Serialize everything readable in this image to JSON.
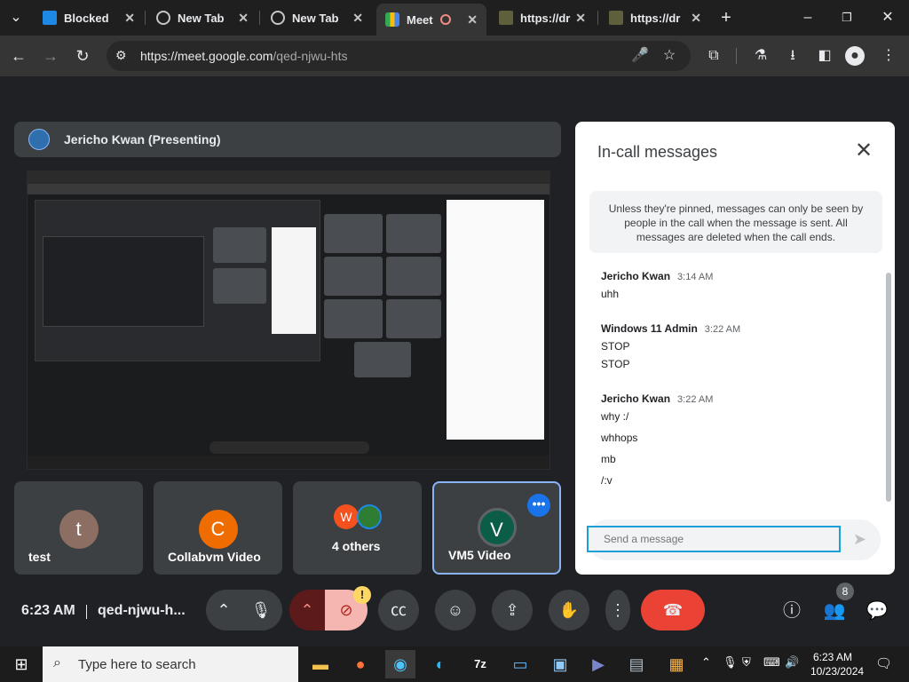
{
  "browser": {
    "tabs": [
      {
        "label": "Blocked",
        "active": false
      },
      {
        "label": "New Tab",
        "active": false
      },
      {
        "label": "New Tab",
        "active": false
      },
      {
        "label": "Meet",
        "active": true
      },
      {
        "label": "https://dr",
        "active": false
      },
      {
        "label": "https://dr",
        "active": false
      }
    ],
    "url_host": "https://meet.google.com",
    "url_path": "/qed-njwu-hts"
  },
  "presentation": {
    "presenter_label": "Jericho Kwan (Presenting)"
  },
  "tiles": [
    {
      "name": "test",
      "avatar_letter": "t",
      "avatar_color": "#8d6e63"
    },
    {
      "name": "Collabvm Video",
      "avatar_letter": "C",
      "avatar_color": "#ef6c00"
    },
    {
      "name": "4 others",
      "avatar_letter": "W",
      "avatar_color": "#f4511e"
    },
    {
      "name": "VM5 Video",
      "avatar_letter": "V",
      "avatar_color": "#0b5d4a",
      "more_label": "•••"
    }
  ],
  "chat": {
    "title": "In-call messages",
    "notice": "Unless they're pinned, messages can only be seen by people in the call when the message is sent. All messages are deleted when the call ends.",
    "messages": [
      {
        "sender": "Jericho Kwan",
        "time": "3:14 AM",
        "lines": [
          "uhh"
        ]
      },
      {
        "sender": "Windows 11 Admin",
        "time": "3:22 AM",
        "lines": [
          "STOP",
          "STOP"
        ]
      },
      {
        "sender": "Jericho Kwan",
        "time": "3:22 AM",
        "lines": [
          "why :/",
          "whhops",
          "mb",
          "/:v"
        ]
      }
    ],
    "input_placeholder": "Send a message"
  },
  "controls": {
    "time": "6:23 AM",
    "meeting_code": "qed-njwu-h...",
    "warning_mark": "!",
    "people_count": "8"
  },
  "taskbar": {
    "search_placeholder": "Type here to search",
    "clock_time": "6:23 AM",
    "clock_date": "10/23/2024"
  },
  "colors": {
    "accent": "#8ab4f8",
    "end_call": "#ea4335",
    "focus_outline": "#1a9fd6"
  }
}
